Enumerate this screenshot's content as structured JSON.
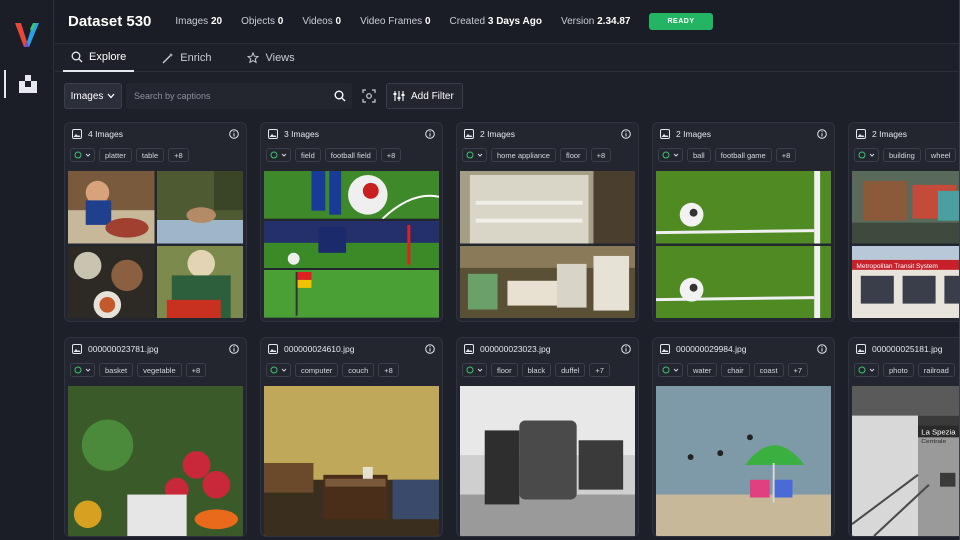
{
  "header": {
    "title": "Dataset 530",
    "images_label": "Images",
    "images_value": "20",
    "objects_label": "Objects",
    "objects_value": "0",
    "videos_label": "Videos",
    "videos_value": "0",
    "frames_label": "Video Frames",
    "frames_value": "0",
    "created_label": "Created",
    "created_value": "3 Days Ago",
    "version_label": "Version",
    "version_value": "2.34.87",
    "status": "READY",
    "status_color": "#23b464"
  },
  "tabs": [
    {
      "label": "Explore",
      "icon": "search-icon",
      "active": true
    },
    {
      "label": "Enrich",
      "icon": "magic-wand-icon",
      "active": false
    },
    {
      "label": "Views",
      "icon": "star-icon",
      "active": false
    }
  ],
  "toolbar": {
    "type_select": "Images",
    "search_placeholder": "Search by captions",
    "add_filter": "Add Filter"
  },
  "cards": [
    {
      "title": "4 Images",
      "tags": [
        "platter",
        "table",
        "+8"
      ]
    },
    {
      "title": "3 Images",
      "tags": [
        "field",
        "football field",
        "+8"
      ]
    },
    {
      "title": "2 Images",
      "tags": [
        "home appliance",
        "floor",
        "+8"
      ]
    },
    {
      "title": "2 Images",
      "tags": [
        "ball",
        "football game",
        "+8"
      ]
    },
    {
      "title": "2 Images",
      "tags": [
        "building",
        "wheel"
      ]
    },
    {
      "title": "000000023781.jpg",
      "tags": [
        "basket",
        "vegetable",
        "+8"
      ]
    },
    {
      "title": "000000024610.jpg",
      "tags": [
        "computer",
        "couch",
        "+8"
      ]
    },
    {
      "title": "000000023023.jpg",
      "tags": [
        "floor",
        "black",
        "duffel",
        "+7"
      ]
    },
    {
      "title": "000000029984.jpg",
      "tags": [
        "water",
        "chair",
        "coast",
        "+7"
      ]
    },
    {
      "title": "000000025181.jpg",
      "tags": [
        "photo",
        "railroad"
      ]
    }
  ],
  "image_text": {
    "station_sign": "La Spezia",
    "station_sign2": "Centrale",
    "tram_sign": "Metropolitan Transit System"
  }
}
